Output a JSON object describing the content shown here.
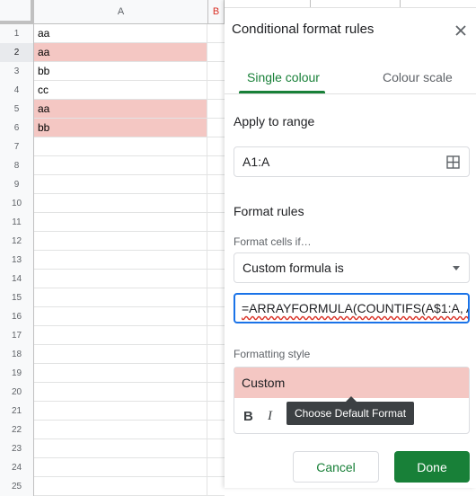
{
  "sheet": {
    "column_header": "A",
    "next_column_header": "B",
    "rows": [
      {
        "num": "1",
        "value": "aa",
        "highlight": false
      },
      {
        "num": "2",
        "value": "aa",
        "highlight": true
      },
      {
        "num": "3",
        "value": "bb",
        "highlight": false
      },
      {
        "num": "4",
        "value": "cc",
        "highlight": false
      },
      {
        "num": "5",
        "value": "aa",
        "highlight": true
      },
      {
        "num": "6",
        "value": "bb",
        "highlight": true
      },
      {
        "num": "7",
        "value": "",
        "highlight": false
      },
      {
        "num": "8",
        "value": "",
        "highlight": false
      },
      {
        "num": "9",
        "value": "",
        "highlight": false
      },
      {
        "num": "10",
        "value": "",
        "highlight": false
      },
      {
        "num": "11",
        "value": "",
        "highlight": false
      },
      {
        "num": "12",
        "value": "",
        "highlight": false
      },
      {
        "num": "13",
        "value": "",
        "highlight": false
      },
      {
        "num": "14",
        "value": "",
        "highlight": false
      },
      {
        "num": "15",
        "value": "",
        "highlight": false
      },
      {
        "num": "16",
        "value": "",
        "highlight": false
      },
      {
        "num": "17",
        "value": "",
        "highlight": false
      },
      {
        "num": "18",
        "value": "",
        "highlight": false
      },
      {
        "num": "19",
        "value": "",
        "highlight": false
      },
      {
        "num": "20",
        "value": "",
        "highlight": false
      },
      {
        "num": "21",
        "value": "",
        "highlight": false
      },
      {
        "num": "22",
        "value": "",
        "highlight": false
      },
      {
        "num": "23",
        "value": "",
        "highlight": false
      },
      {
        "num": "24",
        "value": "",
        "highlight": false
      },
      {
        "num": "25",
        "value": "",
        "highlight": false
      }
    ],
    "highlight_color": "#f4c7c3"
  },
  "panel": {
    "title": "Conditional format rules",
    "close_icon": "close-icon",
    "tabs": [
      {
        "label": "Single colour",
        "active": true
      },
      {
        "label": "Colour scale",
        "active": false
      }
    ],
    "apply_to_range_heading": "Apply to range",
    "range_value": "A1:A",
    "range_icon": "grid-icon",
    "format_rules_heading": "Format rules",
    "format_cells_if_label": "Format cells if…",
    "condition_value": "Custom formula is",
    "formula_value": "=ARRAYFORMULA(COUNTIFS(A$1:A, A",
    "formatting_style_label": "Formatting style",
    "style_preview": "Custom",
    "bold_label": "B",
    "italic_label": "I",
    "tooltip": "Choose Default Format",
    "cancel_label": "Cancel",
    "done_label": "Done",
    "accent_color": "#188038"
  }
}
